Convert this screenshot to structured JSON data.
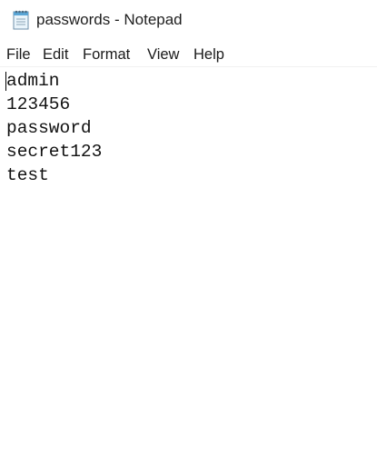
{
  "window": {
    "title": "passwords - Notepad",
    "app_icon": "notepad-icon"
  },
  "menubar": {
    "file": "File",
    "edit": "Edit",
    "format": "Format",
    "view": "View",
    "help": "Help"
  },
  "editor": {
    "lines": [
      "admin",
      "123456",
      "password",
      "secret123",
      "test"
    ]
  }
}
